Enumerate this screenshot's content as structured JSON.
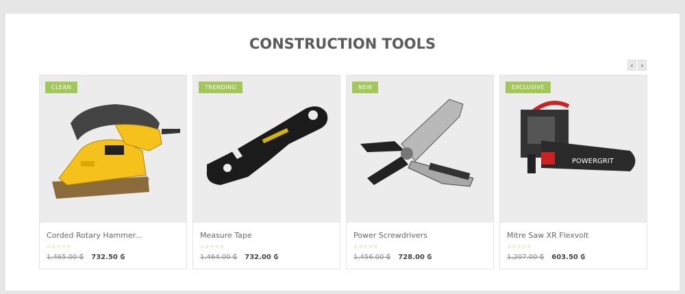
{
  "section": {
    "title": "CONSTRUCTION TOOLS"
  },
  "nav": {
    "prev": "‹",
    "next": "›"
  },
  "products": [
    {
      "badge": "CLEAN",
      "name": "Corded Rotary Hammer...",
      "stars": "☆☆☆☆☆",
      "old_price": "1,465.00 ₲",
      "price": "732.50 ₲",
      "icon": "orbital-sander-image"
    },
    {
      "badge": "TRENDING",
      "name": "Measure Tape",
      "stars": "☆☆☆☆☆",
      "old_price": "1,464.00 ₲",
      "price": "732.00 ₲",
      "icon": "multi-wrench-image"
    },
    {
      "badge": "NEW",
      "name": "Power Screwdrivers",
      "stars": "☆☆☆☆☆",
      "old_price": "1,456.00 ₲",
      "price": "728.00 ₲",
      "icon": "multitool-pliers-image"
    },
    {
      "badge": "EXCLUSIVE",
      "name": "Mitre Saw XR Flexvolt",
      "stars": "☆☆☆☆☆",
      "old_price": "1,207.00 ₲",
      "price": "603.50 ₲",
      "icon": "power-cutter-saw-image"
    }
  ],
  "colors": {
    "badge": "#a3c75b",
    "stars": "#8bc34a",
    "image_bg": "#ececec"
  }
}
